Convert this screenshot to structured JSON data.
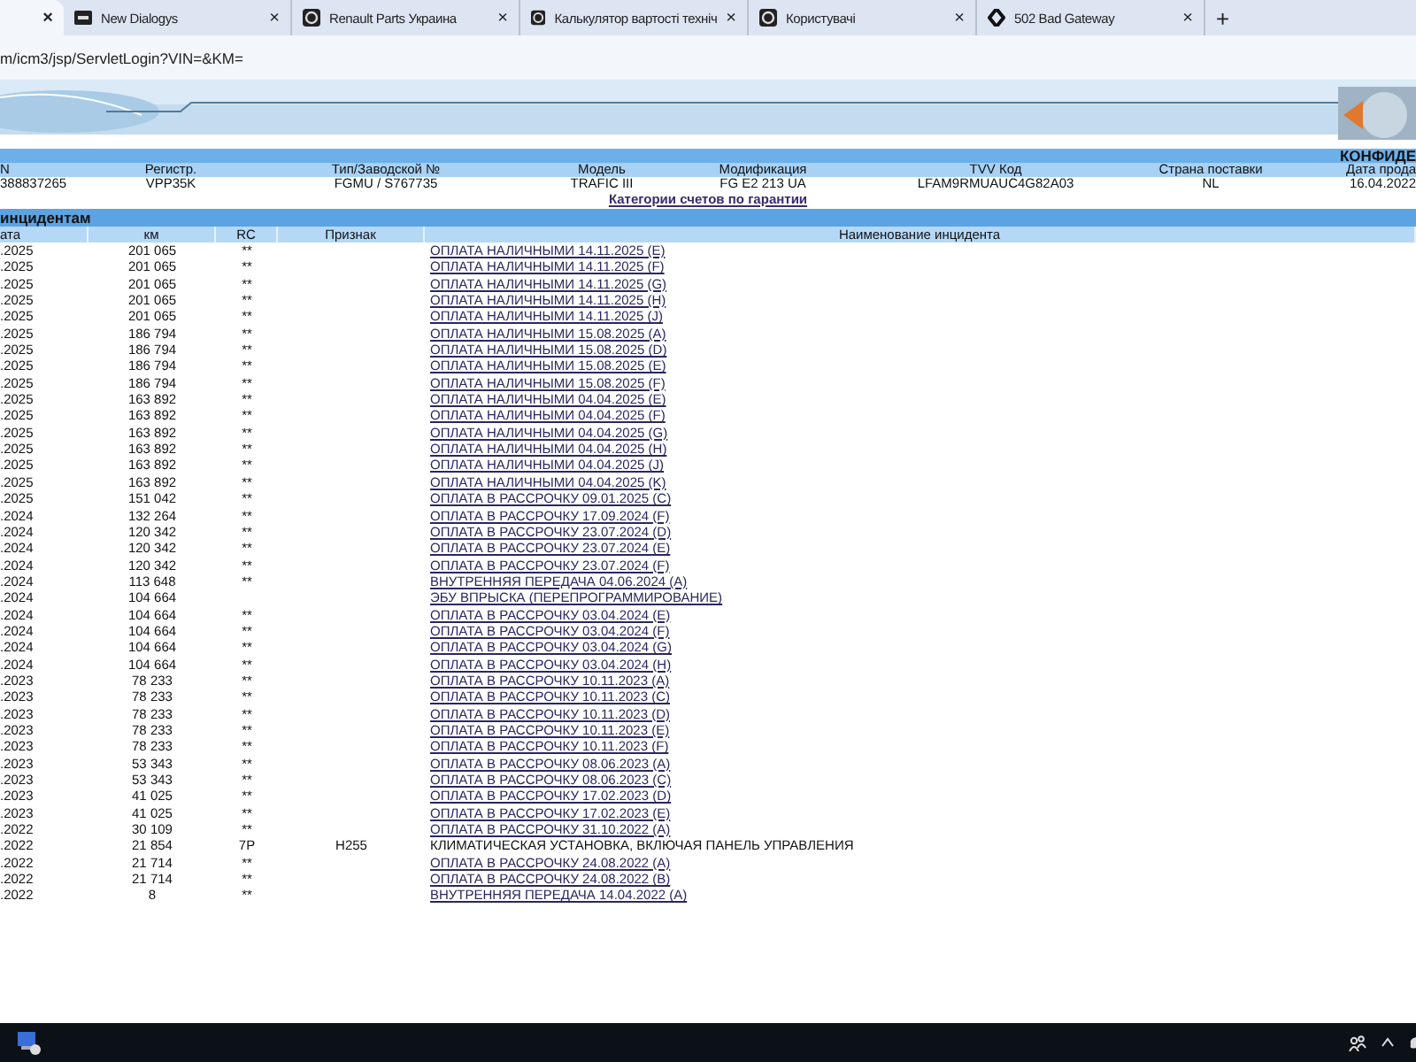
{
  "browser": {
    "tabs": [
      {
        "close": "×",
        "selected": true
      },
      {
        "title": "New Dialogys",
        "kind": "badge",
        "close": "×",
        "selected": false
      },
      {
        "title": "Renault Parts Украина",
        "kind": "round",
        "close": "×",
        "selected": false
      },
      {
        "title": "Калькулятор вартості техніч",
        "kind": "round",
        "close": "×",
        "selected": false
      },
      {
        "title": "Користувачі",
        "kind": "round",
        "close": "×",
        "selected": false
      },
      {
        "title": "502 Bad Gateway",
        "kind": "diamond",
        "close": "×",
        "selected": false
      }
    ],
    "new_tab": "+",
    "address": "m/icm3/jsp/ServletLogin?VIN=&KM="
  },
  "vehicle": {
    "banner": "КОНФИДЕ",
    "columns": [
      "N",
      "Регистр.",
      "Тип/Заводской №",
      "Модель",
      "Модификация",
      "TVV Код",
      "Страна поставки",
      "Дата прода"
    ],
    "values": [
      "388837265",
      "VPP35K",
      "FGMU / S767735",
      "TRAFIC III",
      "FG E2 213 UA",
      "LFAM9RMUAUC4G82A03",
      "NL",
      "16.04.2022"
    ],
    "link": "Категории счетов по гарантии"
  },
  "incidents": {
    "title": "инцидентам",
    "columns": [
      "ата",
      "км",
      "RC",
      "Признак",
      "Наименование инцидента"
    ],
    "rows": [
      {
        "date": ".2025",
        "km": "201 065",
        "rc": "**",
        "name": "ОПЛАТА НАЛИЧНЫМИ 14.11.2025 (E)",
        "link": true
      },
      {
        "date": ".2025",
        "km": "201 065",
        "rc": "**",
        "name": "ОПЛАТА НАЛИЧНЫМИ 14.11.2025 (F)",
        "link": true
      },
      {
        "date": ".2025",
        "km": "201 065",
        "rc": "**",
        "name": "ОПЛАТА НАЛИЧНЫМИ 14.11.2025 (G)",
        "link": true
      },
      {
        "date": ".2025",
        "km": "201 065",
        "rc": "**",
        "name": "ОПЛАТА НАЛИЧНЫМИ 14.11.2025 (H)",
        "link": true
      },
      {
        "date": ".2025",
        "km": "201 065",
        "rc": "**",
        "name": "ОПЛАТА НАЛИЧНЫМИ 14.11.2025 (J)",
        "link": true
      },
      {
        "date": ".2025",
        "km": "186 794",
        "rc": "**",
        "name": "ОПЛАТА НАЛИЧНЫМИ 15.08.2025 (A)",
        "link": true
      },
      {
        "date": ".2025",
        "km": "186 794",
        "rc": "**",
        "name": "ОПЛАТА НАЛИЧНЫМИ 15.08.2025 (D)",
        "link": true
      },
      {
        "date": ".2025",
        "km": "186 794",
        "rc": "**",
        "name": "ОПЛАТА НАЛИЧНЫМИ 15.08.2025 (E)",
        "link": true
      },
      {
        "date": ".2025",
        "km": "186 794",
        "rc": "**",
        "name": "ОПЛАТА НАЛИЧНЫМИ 15.08.2025 (F)",
        "link": true
      },
      {
        "date": ".2025",
        "km": "163 892",
        "rc": "**",
        "name": "ОПЛАТА НАЛИЧНЫМИ 04.04.2025 (E)",
        "link": true
      },
      {
        "date": ".2025",
        "km": "163 892",
        "rc": "**",
        "name": "ОПЛАТА НАЛИЧНЫМИ 04.04.2025 (F)",
        "link": true
      },
      {
        "date": ".2025",
        "km": "163 892",
        "rc": "**",
        "name": "ОПЛАТА НАЛИЧНЫМИ 04.04.2025 (G)",
        "link": true
      },
      {
        "date": ".2025",
        "km": "163 892",
        "rc": "**",
        "name": "ОПЛАТА НАЛИЧНЫМИ 04.04.2025 (H)",
        "link": true
      },
      {
        "date": ".2025",
        "km": "163 892",
        "rc": "**",
        "name": "ОПЛАТА НАЛИЧНЫМИ 04.04.2025 (J)",
        "link": true
      },
      {
        "date": ".2025",
        "km": "163 892",
        "rc": "**",
        "name": "ОПЛАТА НАЛИЧНЫМИ 04.04.2025 (K)",
        "link": true
      },
      {
        "date": ".2025",
        "km": "151 042",
        "rc": "**",
        "name": "ОПЛАТА В РАССРОЧКУ 09.01.2025 (C)",
        "link": true
      },
      {
        "date": ".2024",
        "km": "132 264",
        "rc": "**",
        "name": "ОПЛАТА В РАССРОЧКУ 17.09.2024 (F)",
        "link": true
      },
      {
        "date": ".2024",
        "km": "120 342",
        "rc": "**",
        "name": "ОПЛАТА В РАССРОЧКУ 23.07.2024 (D)",
        "link": true
      },
      {
        "date": ".2024",
        "km": "120 342",
        "rc": "**",
        "name": "ОПЛАТА В РАССРОЧКУ 23.07.2024 (E)",
        "link": true
      },
      {
        "date": ".2024",
        "km": "120 342",
        "rc": "**",
        "name": "ОПЛАТА В РАССРОЧКУ 23.07.2024 (F)",
        "link": true
      },
      {
        "date": ".2024",
        "km": "113 648",
        "rc": "**",
        "name": "ВНУТРЕННЯЯ ПЕРЕДАЧА 04.06.2024 (A)",
        "link": true
      },
      {
        "date": ".2024",
        "km": "104 664",
        "name": "ЭБУ ВПРЫСКА (ПЕРЕПРОГРАММИРОВАНИЕ)",
        "link": true
      },
      {
        "date": ".2024",
        "km": "104 664",
        "rc": "**",
        "name": "ОПЛАТА В РАССРОЧКУ 03.04.2024 (E)",
        "link": true
      },
      {
        "date": ".2024",
        "km": "104 664",
        "rc": "**",
        "name": "ОПЛАТА В РАССРОЧКУ 03.04.2024 (F)",
        "link": true
      },
      {
        "date": ".2024",
        "km": "104 664",
        "rc": "**",
        "name": "ОПЛАТА В РАССРОЧКУ 03.04.2024 (G)",
        "link": true
      },
      {
        "date": ".2024",
        "km": "104 664",
        "rc": "**",
        "name": "ОПЛАТА В РАССРОЧКУ 03.04.2024 (H)",
        "link": true
      },
      {
        "date": ".2023",
        "km": "78 233",
        "rc": "**",
        "name": "ОПЛАТА В РАССРОЧКУ 10.11.2023 (A)",
        "link": true
      },
      {
        "date": ".2023",
        "km": "78 233",
        "rc": "**",
        "name": "ОПЛАТА В РАССРОЧКУ 10.11.2023 (C)",
        "link": true
      },
      {
        "date": ".2023",
        "km": "78 233",
        "rc": "**",
        "name": "ОПЛАТА В РАССРОЧКУ 10.11.2023 (D)",
        "link": true
      },
      {
        "date": ".2023",
        "km": "78 233",
        "rc": "**",
        "name": "ОПЛАТА В РАССРОЧКУ 10.11.2023 (E)",
        "link": true
      },
      {
        "date": ".2023",
        "km": "78 233",
        "rc": "**",
        "name": "ОПЛАТА В РАССРОЧКУ 10.11.2023 (F)",
        "link": true
      },
      {
        "date": ".2023",
        "km": "53 343",
        "rc": "**",
        "name": "ОПЛАТА В РАССРОЧКУ 08.06.2023 (A)",
        "link": true
      },
      {
        "date": ".2023",
        "km": "53 343",
        "rc": "**",
        "name": "ОПЛАТА В РАССРОЧКУ 08.06.2023 (C)",
        "link": true
      },
      {
        "date": ".2023",
        "km": "41 025",
        "rc": "**",
        "name": "ОПЛАТА В РАССРОЧКУ 17.02.2023 (D)",
        "link": true
      },
      {
        "date": ".2023",
        "km": "41 025",
        "rc": "**",
        "name": "ОПЛАТА В РАССРОЧКУ 17.02.2023 (E)",
        "link": true
      },
      {
        "date": ".2022",
        "km": "30 109",
        "rc": "**",
        "name": "ОПЛАТА В РАССРОЧКУ 31.10.2022 (A)",
        "link": true
      },
      {
        "date": ".2022",
        "km": "21 854",
        "rc": "7P",
        "sign": "H255",
        "name": "КЛИМАТИЧЕСКАЯ УСТАНОВКА, ВКЛЮЧАЯ ПАНЕЛЬ УПРАВЛЕНИЯ",
        "link": false
      },
      {
        "date": ".2022",
        "km": "21 714",
        "rc": "**",
        "name": "ОПЛАТА В РАССРОЧКУ 24.08.2022 (A)",
        "link": true
      },
      {
        "date": ".2022",
        "km": "21 714",
        "rc": "**",
        "name": "ОПЛАТА В РАССРОЧКУ 24.08.2022 (B)",
        "link": true
      },
      {
        "date": ".2022",
        "km": "8",
        "rc": "**",
        "name": "ВНУТРЕННЯЯ ПЕРЕДАЧА 14.04.2022 (A)",
        "link": true
      }
    ]
  }
}
